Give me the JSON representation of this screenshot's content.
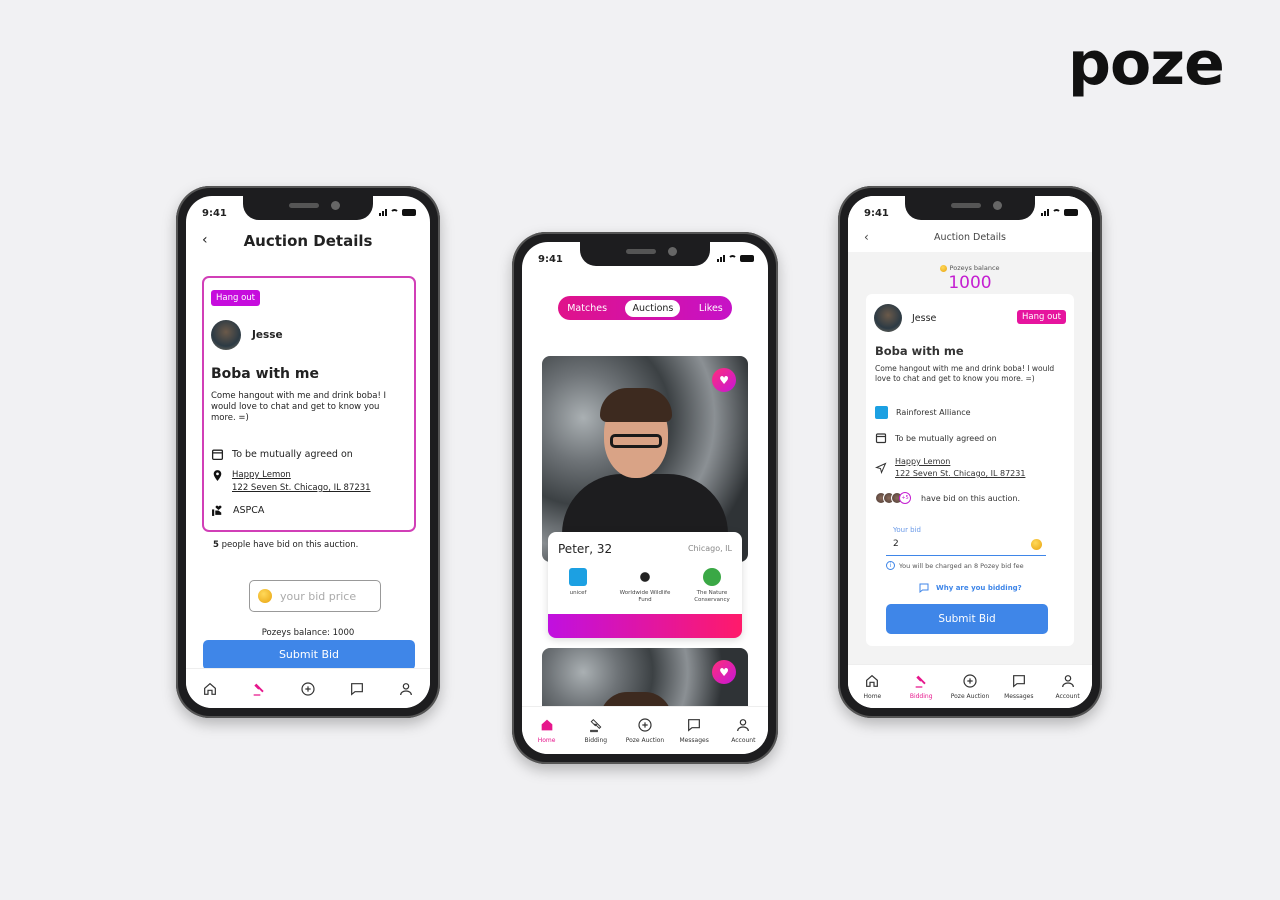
{
  "brand": {
    "logo": "poze"
  },
  "phone_left": {
    "status_time": "9:41",
    "header_title": "Auction Details",
    "back_icon": "‹",
    "tag": "Hang out",
    "host_name": "Jesse",
    "auction_title": "Boba with me",
    "description": "Come hangout with me and drink boba! I would love to chat and get to know you more. =)",
    "date": "To be mutually agreed on",
    "venue_name": "Happy Lemon",
    "venue_address": "122 Seven St. Chicago, IL 87231",
    "charity": "ASPCA",
    "bid_count": "5",
    "bid_count_suffix": " people have bid on this auction.",
    "bid_placeholder": "your bid price",
    "balance_text": "Pozeys balance: 1000",
    "submit_label": "Submit Bid"
  },
  "phone_center": {
    "status_time": "9:41",
    "tabs": [
      {
        "label": "Matches",
        "active": false
      },
      {
        "label": "Auctions",
        "active": true
      },
      {
        "label": "Likes",
        "active": false
      }
    ],
    "profile": {
      "name_age": "Peter, 32",
      "location": "Chicago, IL"
    },
    "charities": [
      {
        "name": "unicef",
        "color": "#1ca0e2"
      },
      {
        "name": "Worldwide Wildlife Fund",
        "color": "#222222"
      },
      {
        "name": "The Nature Conservancy",
        "color": "#3aa845"
      }
    ]
  },
  "phone_right": {
    "status_time": "9:41",
    "header_title": "Auction Details",
    "balance_label": "Pozeys balance",
    "balance_value": "1000",
    "host_name": "Jesse",
    "tag": "Hang out",
    "auction_title": "Boba with me",
    "description": "Come hangout with me and drink boba! I would love to chat and get to know you more. =)",
    "charity": "Rainforest Alliance",
    "date": "To be mutually agreed on",
    "venue_name": "Happy Lemon",
    "venue_address": "122 Seven St. Chicago, IL 87231",
    "bidders_more": "+5",
    "bidders_text": "have bid on this auction.",
    "bid_label": "Your bid",
    "bid_value": "2",
    "fee_note": "You will be charged an 8 Pozey bid fee",
    "why_link": "Why are you bidding?",
    "submit_label": "Submit Bid"
  },
  "nav": {
    "items": [
      {
        "label": "Home",
        "icon": "home-icon"
      },
      {
        "label": "Bidding",
        "icon": "gavel-icon"
      },
      {
        "label": "Poze Auction",
        "icon": "plus-circle-icon"
      },
      {
        "label": "Messages",
        "icon": "message-icon"
      },
      {
        "label": "Account",
        "icon": "user-icon"
      }
    ]
  },
  "colors": {
    "accent_pink": "#e6168c",
    "accent_purple": "#c60cdd",
    "button_blue": "#3f86e8"
  }
}
